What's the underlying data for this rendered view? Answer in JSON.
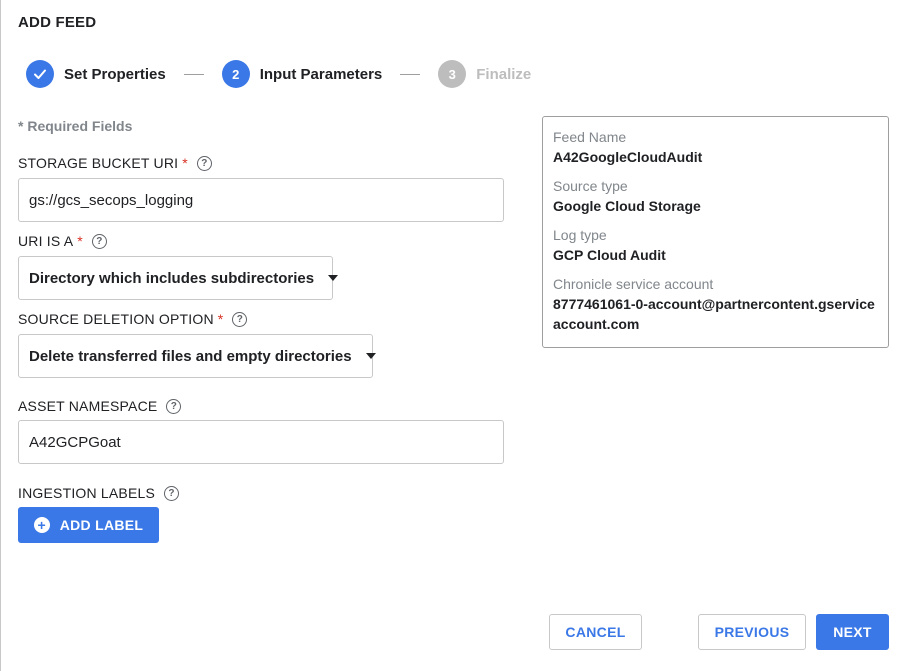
{
  "dialog": {
    "title": "ADD FEED"
  },
  "stepper": {
    "steps": [
      {
        "number": "✓",
        "label": "Set Properties",
        "state": "complete"
      },
      {
        "number": "2",
        "label": "Input Parameters",
        "state": "active"
      },
      {
        "number": "3",
        "label": "Finalize",
        "state": "upcoming"
      }
    ]
  },
  "form": {
    "required_note": "* Required Fields",
    "storage_bucket_uri": {
      "label": "STORAGE BUCKET URI",
      "required": "*",
      "value": "gs://gcs_secops_logging"
    },
    "uri_is_a": {
      "label": "URI IS A",
      "required": "*",
      "value": "Directory which includes subdirectories"
    },
    "source_deletion": {
      "label": "SOURCE DELETION OPTION",
      "required": "*",
      "value": "Delete transferred files and empty directories"
    },
    "asset_namespace": {
      "label": "ASSET NAMESPACE",
      "value": "A42GCPGoat"
    },
    "ingestion_labels": {
      "label": "INGESTION LABELS",
      "add_button": "ADD LABEL"
    }
  },
  "summary": {
    "feed_name": {
      "label": "Feed Name",
      "value": "A42GoogleCloudAudit"
    },
    "source_type": {
      "label": "Source type",
      "value": "Google Cloud Storage"
    },
    "log_type": {
      "label": "Log type",
      "value": "GCP Cloud Audit"
    },
    "service_account": {
      "label": "Chronicle service account",
      "value": "8777461061-0-account@partnercontent.gserviceaccount.com"
    }
  },
  "footer": {
    "cancel": "CANCEL",
    "previous": "PREVIOUS",
    "next": "NEXT"
  },
  "colors": {
    "accent": "#3b78e7",
    "required": "#d93025",
    "muted": "#bdbdbd"
  },
  "icons": {
    "complete": "check-icon",
    "help": "help-circle-icon",
    "add": "plus-circle-icon",
    "dropdown": "caret-down-icon"
  }
}
